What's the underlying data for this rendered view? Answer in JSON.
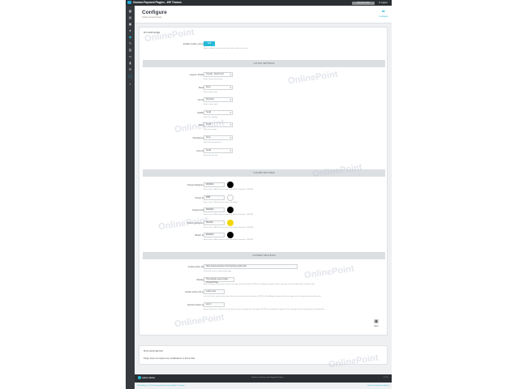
{
  "app": {
    "title": "Onclave Payment Plugins - WE Themes",
    "top_button": "Visit your store",
    "logout": "Logout"
  },
  "sidebar": {
    "items": [
      "dashboard-icon",
      "orders-icon",
      "catalog-icon",
      "customers-icon",
      "modules-icon",
      "design-icon",
      "shipping-icon",
      "payment-icon",
      "stats-icon",
      "advanced-icon",
      "connect-icon",
      "settings-icon"
    ]
  },
  "header": {
    "title": "Configure",
    "breadcrumb": "Cookie Consent Plugin",
    "configure_label": "Configure"
  },
  "panel_configure": {
    "title": "CONFIGURE",
    "enable_label": "Enable cookie_consent",
    "enable_value": "YES",
    "enable_hint": "When enabled, cookie consent bar will be visible to the user",
    "layout_section": "LAYOUT SETTINGS",
    "layout": [
      {
        "label": "Layout / Position",
        "value": "Overlay - Bottom left",
        "hint": "Select layout and position"
      },
      {
        "label": "Border",
        "value": "None",
        "hint": "Select border style"
      },
      {
        "label": "Corners",
        "value": "Rounded",
        "hint": "Select corner style"
      },
      {
        "label": "Padding",
        "value": "Small",
        "hint": "Select the padding"
      },
      {
        "label": "Margin",
        "value": "Small",
        "hint": "Select the margin"
      },
      {
        "label": "Transparency",
        "value": "None",
        "hint": "Select the transparency"
      },
      {
        "label": "Font size",
        "value": "Small",
        "hint": "Select the font size"
      }
    ],
    "colors_section": "COLORS SETTINGS",
    "colors": [
      {
        "label": "Popup background",
        "value": "#000000",
        "swatch": "#000000",
        "hint": "Enter color in HEX format or select with picker. Example: #FFFFFF"
      },
      {
        "label": "Popup text",
        "value": "#ffffff",
        "swatch": "#ffffff",
        "hint": "Enter color in HEX format or select with picker"
      },
      {
        "label": "Popup border",
        "value": "#000000",
        "swatch": "#000000",
        "hint": "Enter color in HEX format or select with picker. Example: #FFFFFF"
      },
      {
        "label": "Button background",
        "value": "#f1d600",
        "swatch": "#f1d600",
        "hint": "Enter color in HEX format or select with picker. Example: #FFFFFF"
      },
      {
        "label": "Button text",
        "value": "#000000",
        "swatch": "#000000",
        "hint": "Enter color in HEX format or select with picker. Example: #FFFFFF"
      }
    ],
    "content_section": "CONTENT SETTINGS",
    "content": [
      {
        "label": "Cookie policy URL",
        "value": "https://www.example.com/en/privacy-policy.php",
        "hint": "Is the URL of your cookie policy page"
      },
      {
        "label": "Message",
        "value": "This website uses Cookie Consent Plugi",
        "hint": "Add a message connected: Long text message from translation FR PB for FrontMagical support. Enter message can be changed from translation file."
      },
      {
        "label": "Cookie policy link text",
        "value": "Learn more",
        "hint": "Link text for the cookie policy page link in your message from translation FR PB for FrontMagical support. Enter message can be changed from translation file."
      },
      {
        "label": "Dismiss button text",
        "value": "Got it!",
        "hint": "Accept button text, Label text for the button in your message from translation FR PB for FrontMagical support. Enter message can be changed from translation file."
      }
    ],
    "save_label": "Save"
  },
  "panel_setup": {
    "title": "PLUGIN SETUP",
    "text": "Plugin does not require any modifications in theme files."
  },
  "bottombar": {
    "marketplace": "Addons Market",
    "links": "Contact us   Visit our store   Support   Partners",
    "version": "1.7.5.0"
  },
  "footer": {
    "left": "PrestaShop 1.7.5.0   Documentation   Forums   Addons   Training",
    "right": "Online Development Market"
  },
  "watermark": "OnlinePoint",
  "colors": {
    "accent": "#25b9d7",
    "topbar": "#2b2f33",
    "sidebar": "#363a3f"
  }
}
